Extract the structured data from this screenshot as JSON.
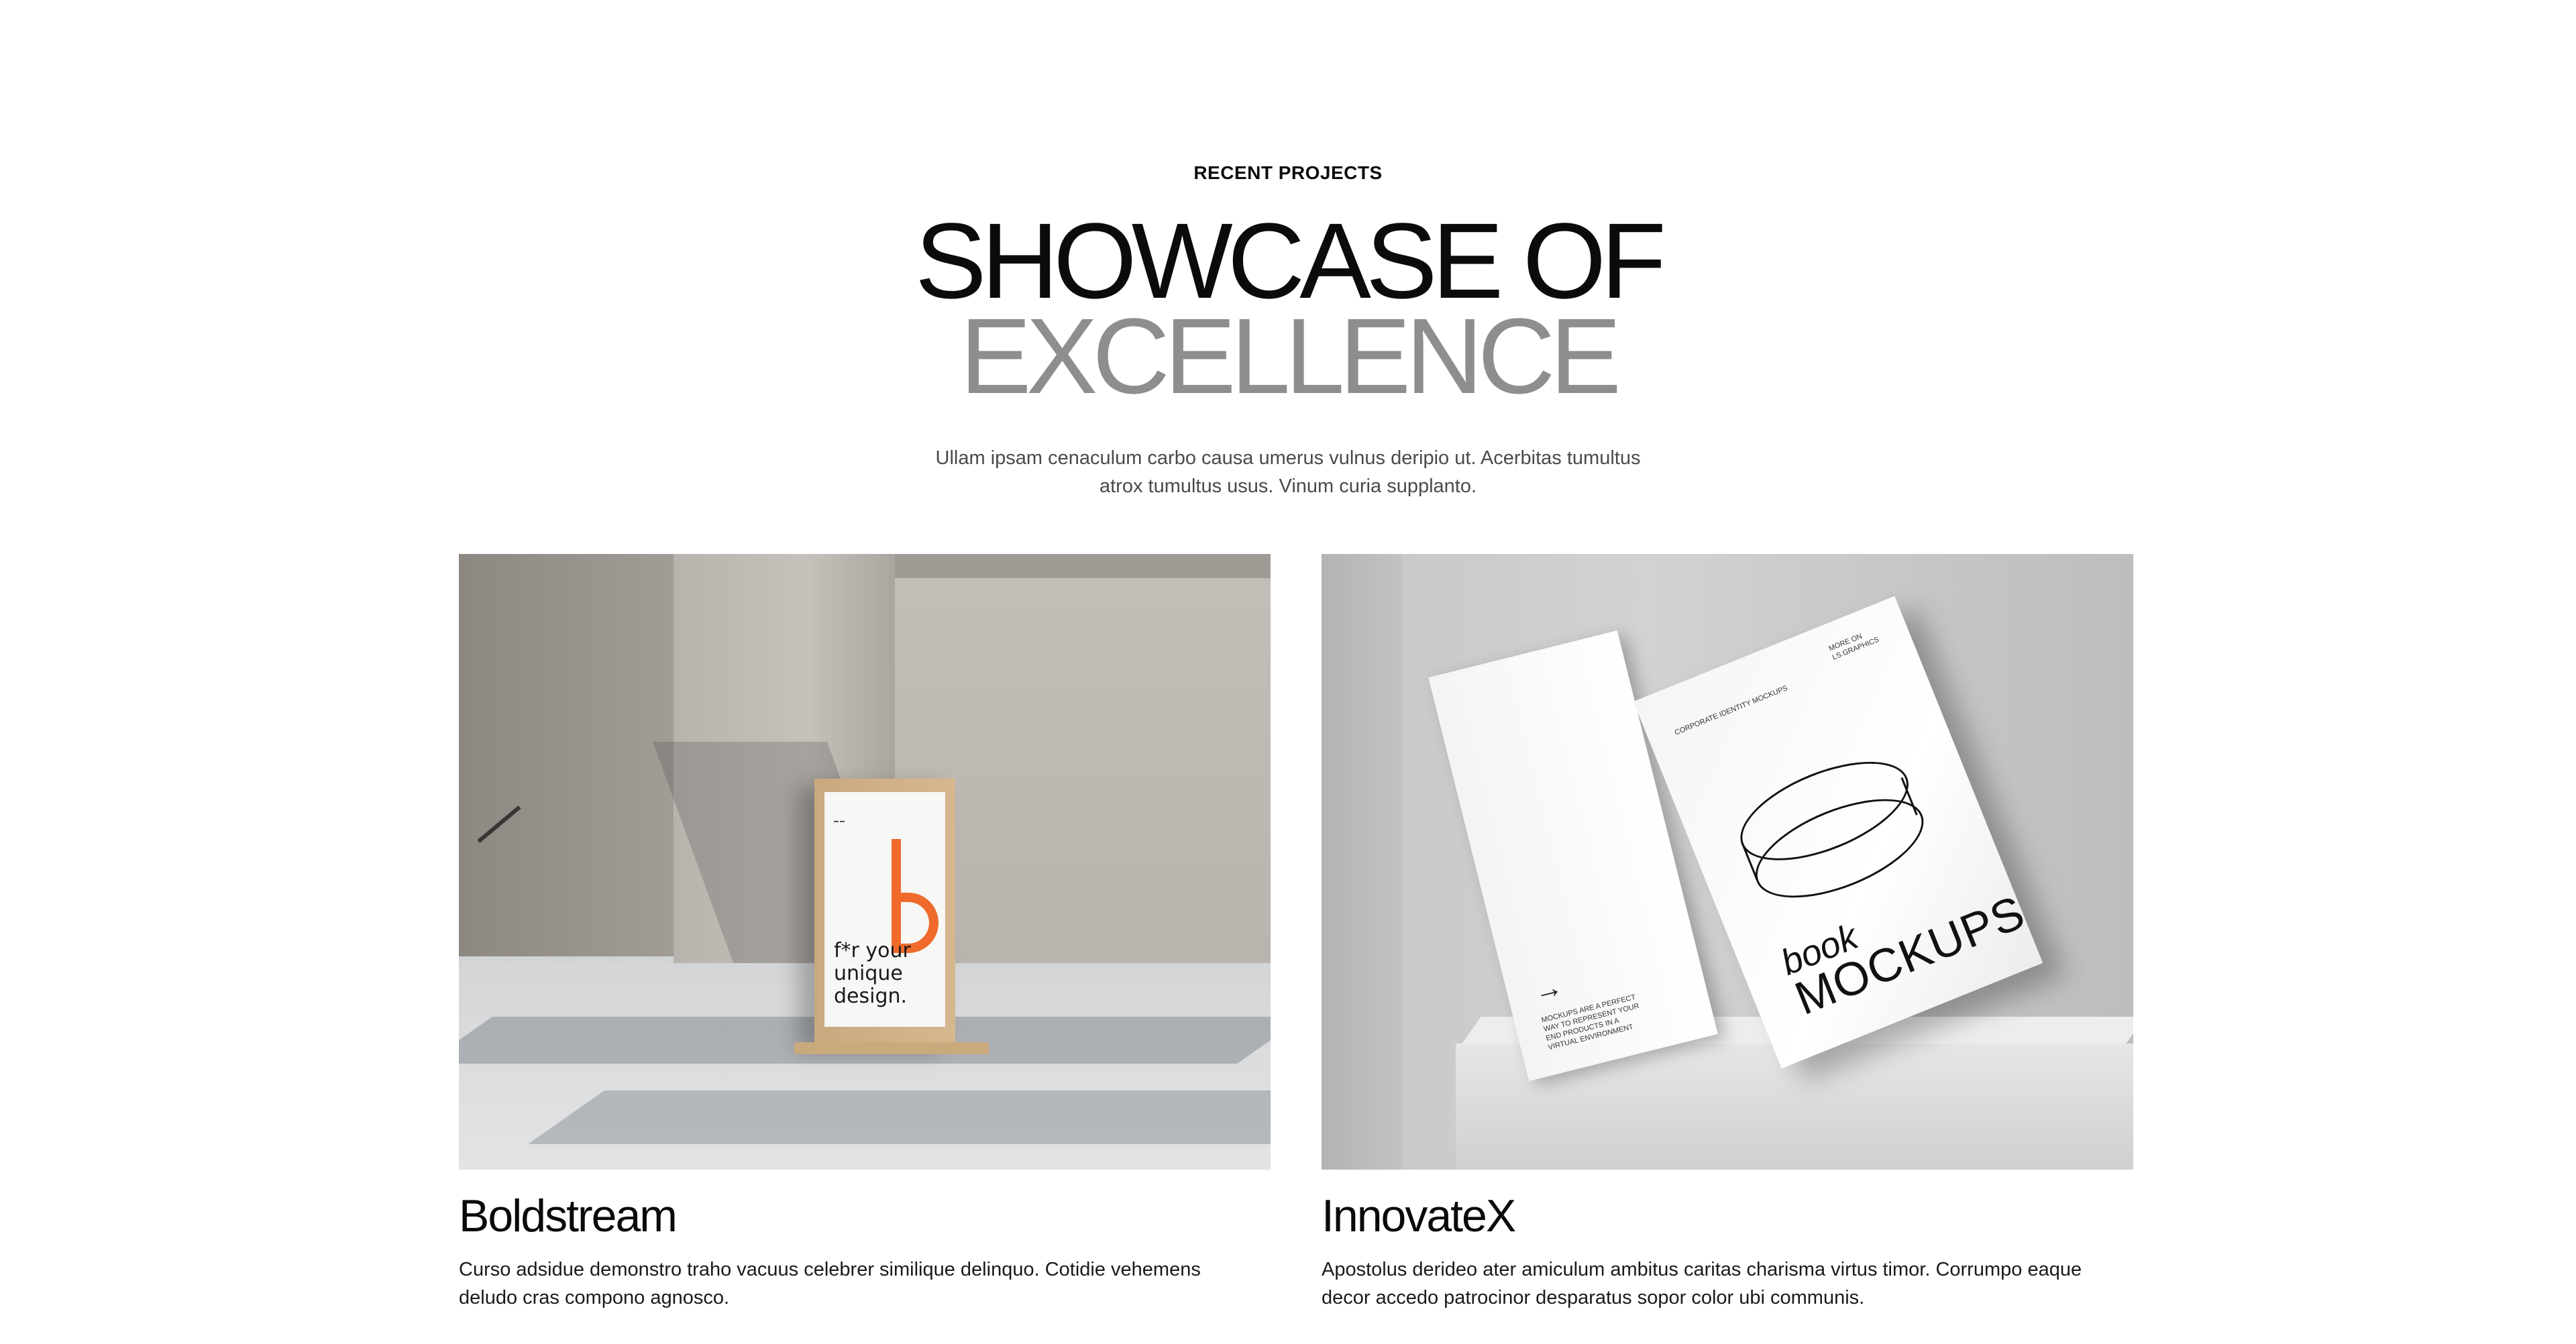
{
  "section": {
    "eyebrow": "RECENT PROJECTS",
    "title_line1": "SHOWCASE OF",
    "title_line2": "EXCELLENCE",
    "intro": "Ullam ipsam cenaculum carbo causa umerus vulnus deripio ut. Acerbitas tumultus atrox tumultus usus. Vinum curia supplanto."
  },
  "projects": [
    {
      "title": "Boldstream",
      "description": "Curso adsidue demonstro traho vacuus celebrer similique delinquo. Cotidie vehemens deludo cras compono agnosco.",
      "image": {
        "poster_text": "f*r your unique design."
      }
    },
    {
      "title": "InnovateX",
      "description": "Apostolus derideo ater amiculum ambitus caritas charisma virtus timor. Corrumpo eaque decor accedo patrocinor desparatus sopor color ubi communis.",
      "image": {
        "cover_word_1": "book",
        "cover_word_2": "MOCKUPS",
        "back_text": "MOCKUPS ARE A PERFECT WAY TO REPRESENT YOUR END PRODUCTS IN A VIRTUAL ENVIRONMENT",
        "cover_label": "CORPORATE IDENTITY MOCKUPS",
        "cover_label_2": "MORE ON LS.GRAPHICS",
        "arrow_icon": "arrow-right-icon"
      }
    }
  ],
  "colors": {
    "title_dark": "#0b0b0b",
    "title_light": "#8e8e8e",
    "accent_orange": "#ef6a2b"
  }
}
